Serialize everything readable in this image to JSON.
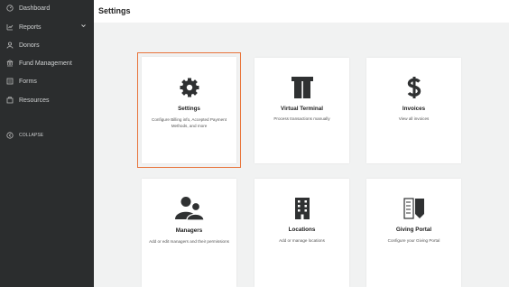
{
  "sidebar": {
    "items": [
      {
        "label": "Dashboard",
        "icon": "dashboard-icon"
      },
      {
        "label": "Reports",
        "icon": "reports-icon",
        "has_submenu": true
      },
      {
        "label": "Donors",
        "icon": "user-icon"
      },
      {
        "label": "Fund Management",
        "icon": "fund-icon"
      },
      {
        "label": "Forms",
        "icon": "forms-icon"
      },
      {
        "label": "Resources",
        "icon": "resources-icon"
      }
    ],
    "collapse_label": "COLLAPSE"
  },
  "header": {
    "title": "Settings"
  },
  "cards": [
    {
      "title": "Settings",
      "description": "Configure Billing info, Accepted Payment Methods, and more",
      "icon": "gear-icon",
      "selected": true
    },
    {
      "title": "Virtual Terminal",
      "description": "Process transactions manually",
      "icon": "terminal-icon"
    },
    {
      "title": "Invoices",
      "description": "View all invoices",
      "icon": "dollar-icon"
    },
    {
      "title": "Managers",
      "description": "Add or edit managers and their permissions",
      "icon": "users-icon"
    },
    {
      "title": "Locations",
      "description": "Add or manage locations",
      "icon": "building-icon"
    },
    {
      "title": "Giving Portal",
      "description": "Configure your Giving Portal",
      "icon": "portal-icon"
    }
  ],
  "colors": {
    "sidebar_bg": "#2b2d2e",
    "accent": "#e8743b",
    "icon": "#2f3132"
  }
}
